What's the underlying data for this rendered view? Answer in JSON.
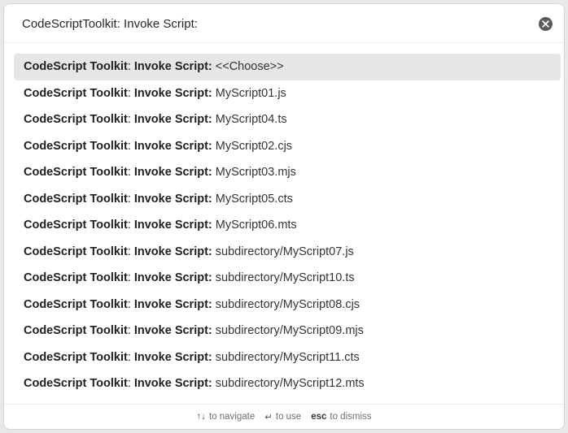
{
  "prompt": {
    "value": "CodeScriptToolkit: Invoke Script:"
  },
  "suggestions": [
    {
      "plugin": "CodeScript Toolkit",
      "command": "Invoke Script",
      "value": "<<Choose>>",
      "selected": true
    },
    {
      "plugin": "CodeScript Toolkit",
      "command": "Invoke Script",
      "value": "MyScript01.js"
    },
    {
      "plugin": "CodeScript Toolkit",
      "command": "Invoke Script",
      "value": "MyScript04.ts"
    },
    {
      "plugin": "CodeScript Toolkit",
      "command": "Invoke Script",
      "value": "MyScript02.cjs"
    },
    {
      "plugin": "CodeScript Toolkit",
      "command": "Invoke Script",
      "value": "MyScript03.mjs"
    },
    {
      "plugin": "CodeScript Toolkit",
      "command": "Invoke Script",
      "value": "MyScript05.cts"
    },
    {
      "plugin": "CodeScript Toolkit",
      "command": "Invoke Script",
      "value": "MyScript06.mts"
    },
    {
      "plugin": "CodeScript Toolkit",
      "command": "Invoke Script",
      "value": "subdirectory/MyScript07.js"
    },
    {
      "plugin": "CodeScript Toolkit",
      "command": "Invoke Script",
      "value": "subdirectory/MyScript10.ts"
    },
    {
      "plugin": "CodeScript Toolkit",
      "command": "Invoke Script",
      "value": "subdirectory/MyScript08.cjs"
    },
    {
      "plugin": "CodeScript Toolkit",
      "command": "Invoke Script",
      "value": "subdirectory/MyScript09.mjs"
    },
    {
      "plugin": "CodeScript Toolkit",
      "command": "Invoke Script",
      "value": "subdirectory/MyScript11.cts"
    },
    {
      "plugin": "CodeScript Toolkit",
      "command": "Invoke Script",
      "value": "subdirectory/MyScript12.mts"
    }
  ],
  "separator": ":",
  "footer": {
    "navigate": {
      "key": "↑↓",
      "label": "to navigate"
    },
    "use": {
      "key": "↵",
      "label": "to use"
    },
    "dismiss": {
      "key": "esc",
      "label": "to dismiss"
    }
  },
  "icons": {
    "clear": "close-circle-icon",
    "clear_color": "#5c5c5c"
  },
  "colors": {
    "selected_background": "#e6e6e6",
    "text": "#262626"
  }
}
